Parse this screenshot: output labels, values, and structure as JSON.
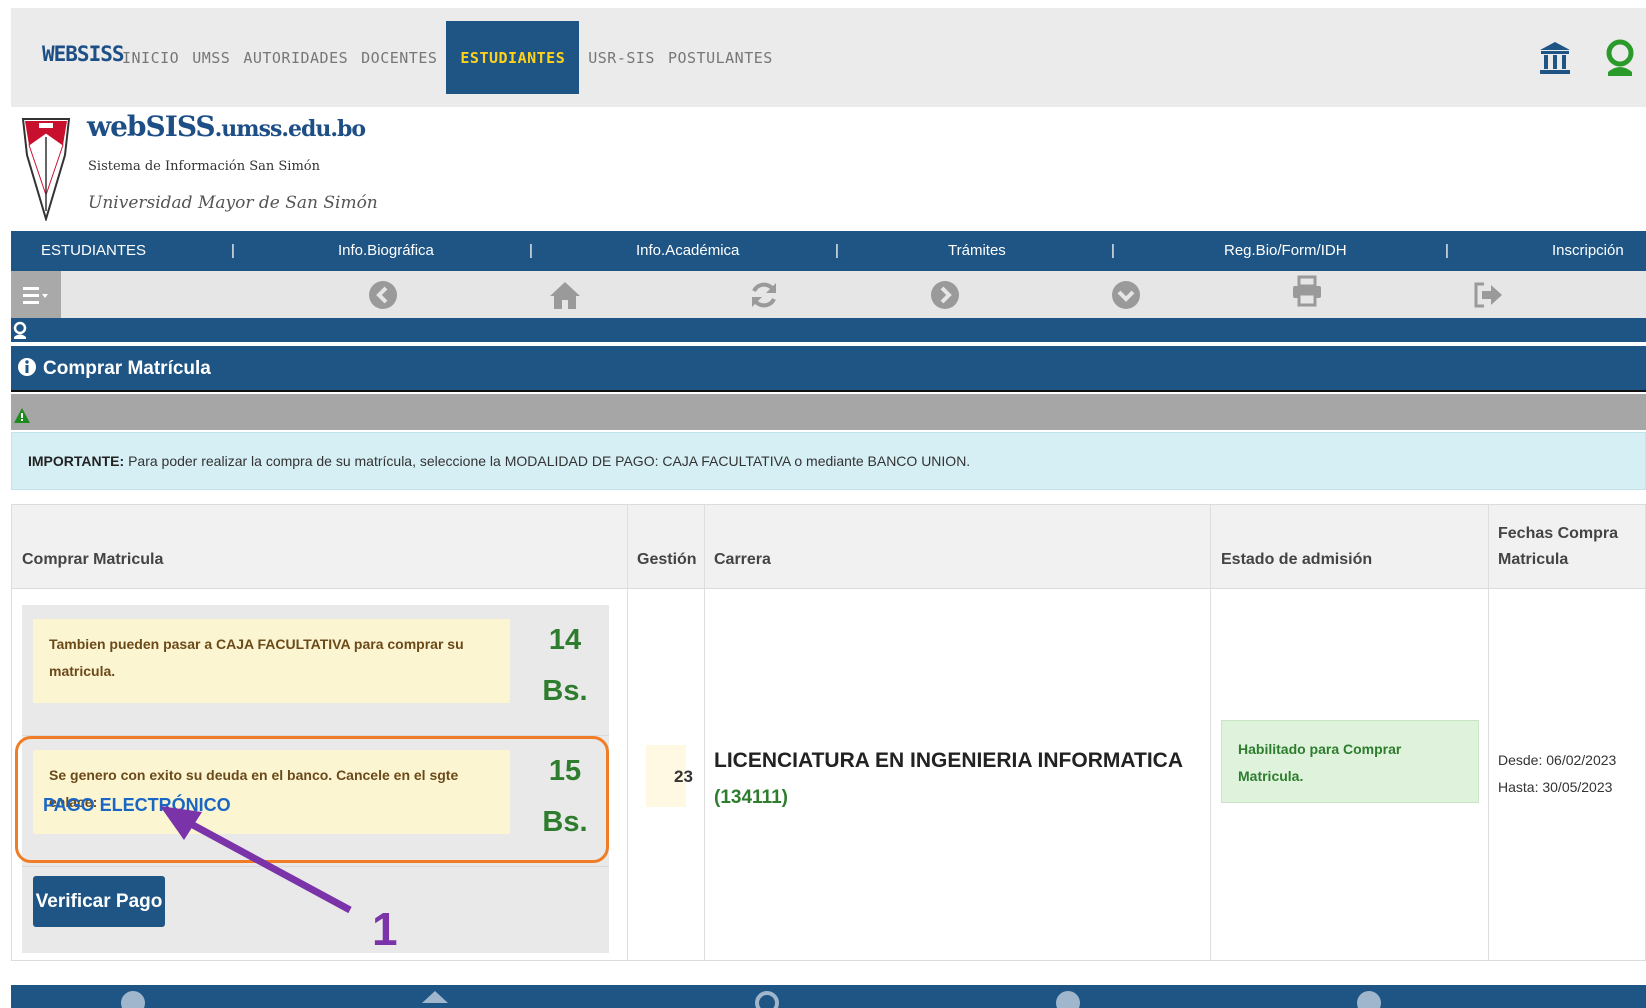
{
  "topbar": {
    "brand": "WEBSISS",
    "menu": [
      "INICIO",
      "UMSS",
      "AUTORIDADES",
      "DOCENTES",
      "ESTUDIANTES",
      "USR-SIS",
      "POSTULANTES"
    ],
    "active": "ESTUDIANTES",
    "icons": [
      "bank-icon",
      "user-icon"
    ]
  },
  "logo": {
    "title_main": "webSISS",
    "title_domain": ".umss.edu.bo",
    "subtitle": "Sistema de Información San Simón",
    "university": "Universidad Mayor de San Simón"
  },
  "mainmenu": {
    "items": [
      "ESTUDIANTES",
      "Info.Biográfica",
      "Info.Académica",
      "Trámites",
      "Reg.Bio/Form/IDH",
      "Inscripción"
    ],
    "separator": "|"
  },
  "toolbar": {
    "icons": [
      "menu-icon",
      "chevron-left-icon",
      "home-icon",
      "refresh-icon",
      "chevron-right-icon",
      "chevron-down-icon",
      "print-icon",
      "logout-icon"
    ]
  },
  "panel": {
    "title": "Comprar Matrícula",
    "notice_strong": "IMPORTANTE:",
    "notice_text": " Para poder realizar la compra de su matrícula, seleccione la MODALIDAD DE PAGO: CAJA FACULTATIVA o mediante BANCO UNION."
  },
  "table": {
    "headers": {
      "comprar": "Comprar Matricula",
      "gestion": "Gestión",
      "carrera": "Carrera",
      "estado": "Estado de admisión",
      "fechas_1": "Fechas Compra",
      "fechas_2": "Matricula"
    },
    "row": {
      "alert_caja": "Tambien pueden pasar a CAJA FACULTATIVA para comprar su matricula.",
      "price_caja_value": "14",
      "price_caja_unit": "Bs.",
      "alert_banco": "Se genero con exito su deuda en el banco. Cancele en el sgte enlace:",
      "pay_link": "PAGO ELECTRÓNICO",
      "price_banco_value": "15",
      "price_banco_unit": "Bs.",
      "verify_button": "Verificar Pago",
      "gestion": "23",
      "carrera_name": "LICENCIATURA EN INGENIERIA INFORMATICA",
      "carrera_code": "(134111)",
      "estado": "Habilitado para Comprar Matricula.",
      "desde": "Desde: 06/02/2023",
      "hasta": "Hasta: 30/05/2023"
    }
  },
  "annotation": {
    "step_number": "1",
    "highlight_color": "#f07d26",
    "arrow_color": "#7a33a8"
  },
  "colors": {
    "primary": "#1e5585",
    "active_text": "#ffd21a",
    "success": "#2e7d2e",
    "link": "#1a66c4"
  }
}
